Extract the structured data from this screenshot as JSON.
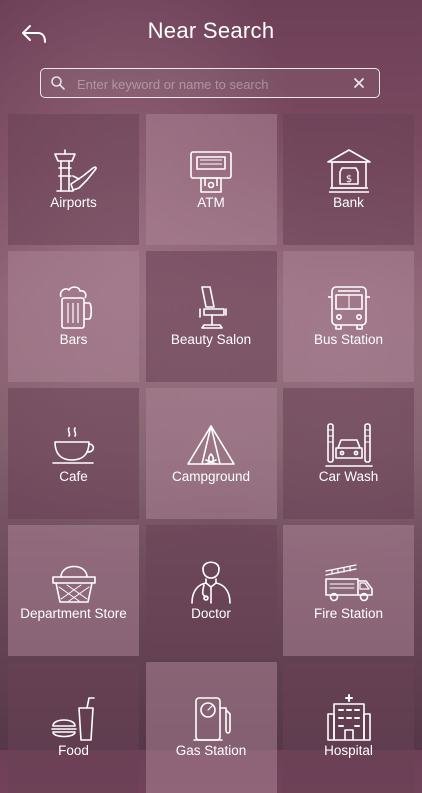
{
  "header": {
    "title": "Near Search"
  },
  "search": {
    "placeholder": "Enter keyword or name to search"
  },
  "categories": [
    {
      "label": "Airports",
      "icon": "airport-tower-plane-icon"
    },
    {
      "label": "ATM",
      "icon": "atm-machine-icon"
    },
    {
      "label": "Bank",
      "icon": "bank-building-icon"
    },
    {
      "label": "Bars",
      "icon": "beer-mug-icon"
    },
    {
      "label": "Beauty Salon",
      "icon": "salon-chair-icon"
    },
    {
      "label": "Bus Station",
      "icon": "bus-icon"
    },
    {
      "label": "Cafe",
      "icon": "coffee-cup-icon"
    },
    {
      "label": "Campground",
      "icon": "tent-campfire-icon"
    },
    {
      "label": "Car Wash",
      "icon": "car-wash-icon"
    },
    {
      "label": "Department Store",
      "icon": "shopping-basket-icon"
    },
    {
      "label": "Doctor",
      "icon": "doctor-icon"
    },
    {
      "label": "Fire Station",
      "icon": "fire-truck-icon"
    },
    {
      "label": "Food",
      "icon": "burger-drink-icon"
    },
    {
      "label": "Gas Station",
      "icon": "fuel-pump-icon"
    },
    {
      "label": "Hospital",
      "icon": "hospital-building-icon"
    }
  ]
}
